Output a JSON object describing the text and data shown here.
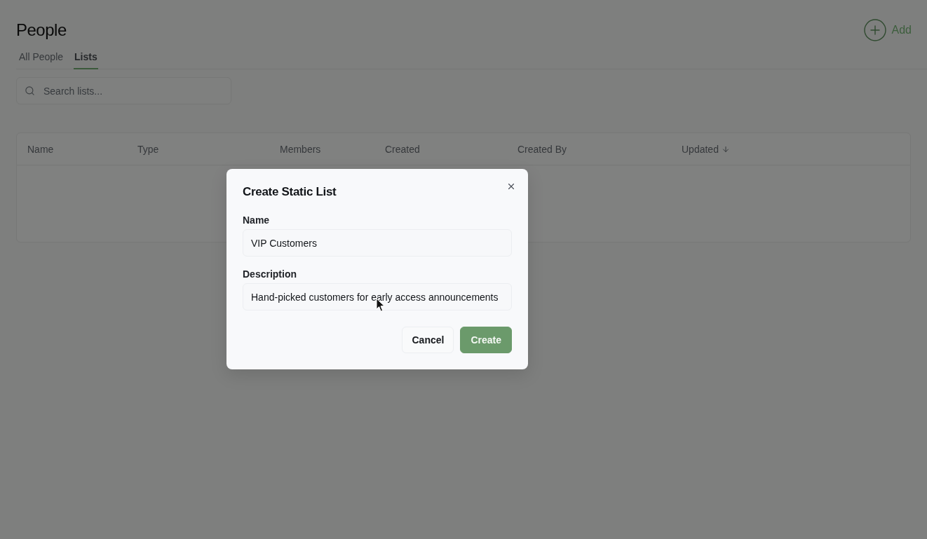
{
  "page": {
    "title": "People",
    "add_button": {
      "label": "Add"
    }
  },
  "tabs": [
    {
      "label": "All People",
      "selected": false
    },
    {
      "label": "Lists",
      "selected": true
    }
  ],
  "search": {
    "placeholder": "Search lists..."
  },
  "table": {
    "columns": [
      {
        "label": "Name",
        "sorted": false
      },
      {
        "label": "Type",
        "sorted": false
      },
      {
        "label": "Members",
        "sorted": false
      },
      {
        "label": "Created",
        "sorted": false
      },
      {
        "label": "Created By",
        "sorted": false
      },
      {
        "label": "Updated",
        "sorted": true
      }
    ]
  },
  "dialog": {
    "title": "Create Static List",
    "fields": [
      {
        "label": "Name",
        "value": "VIP Customers"
      },
      {
        "label": "Description",
        "value": "Hand-picked customers for early access announcements"
      }
    ],
    "buttons": [
      {
        "label": "Cancel",
        "kind": "secondary"
      },
      {
        "label": "Create",
        "kind": "primary"
      }
    ]
  }
}
